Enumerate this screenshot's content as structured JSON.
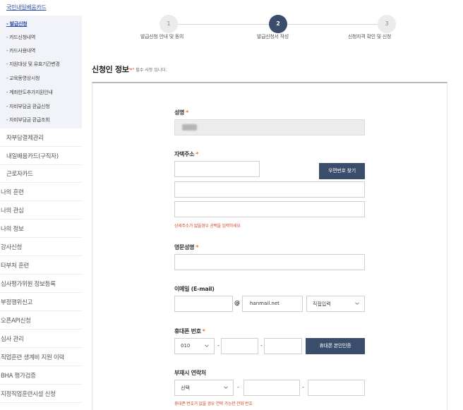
{
  "sidebar": {
    "top_link": "국민내일배움카드",
    "sub_items": [
      {
        "label": "- 발급신청",
        "active": true
      },
      {
        "label": "- 카드신청내역",
        "active": false
      },
      {
        "label": "- 카드사용내역",
        "active": false
      },
      {
        "label": "- 지원대상 및 유효기간변경",
        "active": false
      },
      {
        "label": "- 교육동영상시청",
        "active": false
      },
      {
        "label": "- 계좌한도추가지원안내",
        "active": false
      },
      {
        "label": "- 자비부담금 환급신청",
        "active": false
      },
      {
        "label": "- 자비부담금 환급조회",
        "active": false
      }
    ],
    "items_indented": [
      "자부담결제관리",
      "내일배움카드(구직자)",
      "근로자카드"
    ],
    "items": [
      "나의 훈련",
      "나의 관심",
      "나의 정보",
      "강사신청",
      "타부처 훈련",
      "심사평가위원 정보등록",
      "부정행위신고",
      "오픈API신청",
      "심사 관리",
      "직업훈련 생계비 지원 이력",
      "BHA 평가검증",
      "지정직업훈련시설 신청"
    ]
  },
  "stepper": {
    "steps": [
      {
        "num": "1",
        "label": "발급신청 안내 및 동의"
      },
      {
        "num": "2",
        "label": "발급신청서 작성"
      },
      {
        "num": "3",
        "label": "신청자격 확인 및 신청"
      }
    ],
    "active_index": 1
  },
  "section": {
    "title": "신청인 정보",
    "note_star": "\"*\"",
    "note_text": " 필수 사항 입니다."
  },
  "form": {
    "required_mark": "*",
    "name_label": "성명",
    "address_label": "자택주소",
    "postcode_button": "우편번호 찾기",
    "address_hint": "상세주소가 없을경우 공백을 입력하세요",
    "english_name_label": "영문성명",
    "email_label": "이메일 (E-mail)",
    "email_at": "@",
    "email_domain": "hanmail.net",
    "email_select": "직접입력",
    "phone_label": "휴대폰 번호",
    "phone_prefix": "010",
    "dash": "-",
    "verify_button": "휴대폰 본인인증",
    "alt_contact_label": "부재시 연락처",
    "alt_select": "선택",
    "alt_hint": "휴대폰 번호가 없을 경우 연락 가능한 전화 번호"
  }
}
